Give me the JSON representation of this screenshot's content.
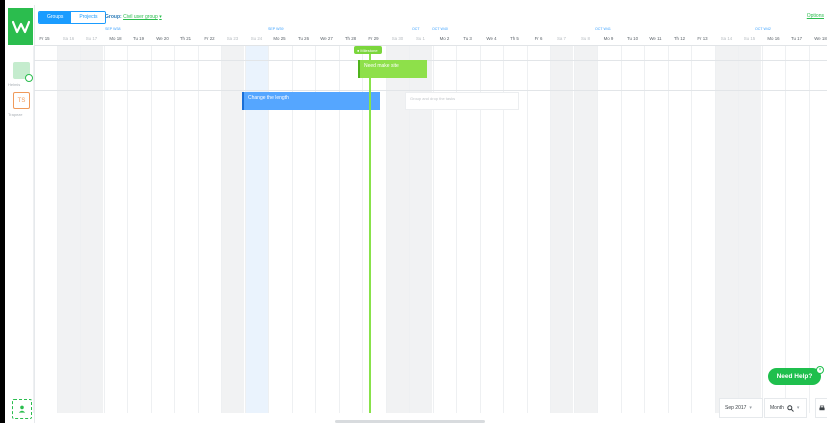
{
  "topbar": {
    "toggle": [
      "Groups",
      "Projects"
    ],
    "group_key": "Group:",
    "group_value": "Civil user group",
    "options": "Options"
  },
  "users": [
    {
      "initials": "",
      "label": "Helmis"
    },
    {
      "initials": "TS",
      "label": "Trapeze"
    }
  ],
  "weeks": [
    "SEP W38",
    "SEP W39",
    "OCT",
    "OCT W40",
    "OCT W41",
    "OCT W42"
  ],
  "days": [
    "Fr 15",
    "Sa 16",
    "Su 17",
    "Mo 18",
    "Tu 19",
    "We 20",
    "Th 21",
    "Fr 22",
    "Sa 23",
    "Su 24",
    "Mo 25",
    "Tu 26",
    "We 27",
    "Th 28",
    "Fr 29",
    "Sa 30",
    "Su 1",
    "Mo 2",
    "Tu 3",
    "We 4",
    "Th 5",
    "Fr 6",
    "Sa 7",
    "Su 8",
    "Mo 9",
    "Tu 10",
    "We 11",
    "Th 12",
    "Fr 13",
    "Sa 14",
    "Su 15",
    "Mo 16",
    "Tu 17",
    "We 18"
  ],
  "milestone": "Milestone",
  "tasks": {
    "green": "Need make site",
    "blue": "Change the length",
    "drop": "Group and drop the tasks"
  },
  "help": "Need Help?",
  "footer": {
    "date": "Sep 2017",
    "zoom": "Month"
  },
  "colors": {
    "brand_green": "#2bbd4e",
    "accent_blue": "#1a9cff",
    "task_green": "#8ee04a",
    "task_blue": "#55a6ff"
  }
}
